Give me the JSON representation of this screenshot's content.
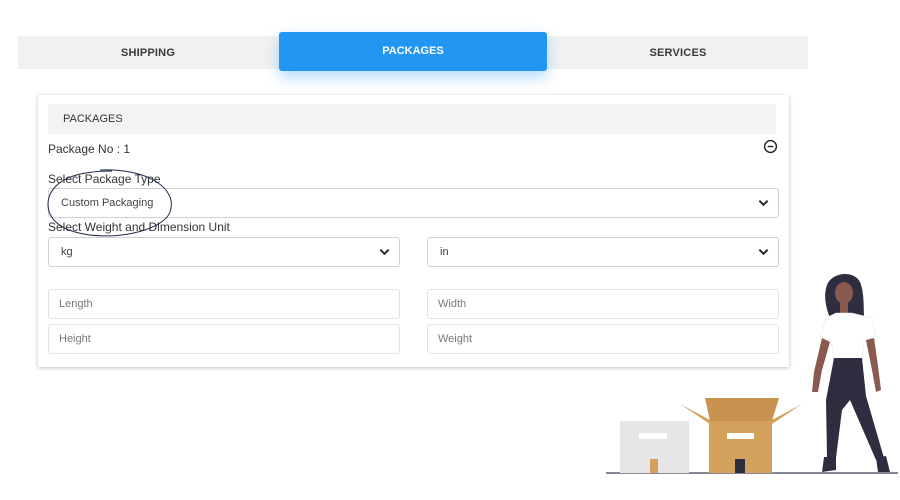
{
  "tabs": {
    "shipping": "SHIPPING",
    "packages": "PACKAGES",
    "services": "SERVICES"
  },
  "card": {
    "header": "PACKAGES",
    "package_no": "Package No : 1",
    "collapse_icon": "minus-circle-icon",
    "package_type_label": "Select Package Type",
    "package_type_value": "Custom Packaging",
    "unit_label": "Select Weight and Dimension Unit",
    "weight_unit_value": "kg",
    "dimension_unit_value": "in",
    "length_placeholder": "Length",
    "width_placeholder": "Width",
    "height_placeholder": "Height",
    "weight_placeholder": "Weight"
  },
  "colors": {
    "accent": "#2196f3",
    "tab_bar": "#f1f1f1",
    "box_brown": "#d3a15c",
    "box_grey": "#e6e6e6",
    "figure_skin": "#8a5a4e",
    "figure_dark": "#2f2e41"
  },
  "illustration": "person-with-boxes-illustration"
}
